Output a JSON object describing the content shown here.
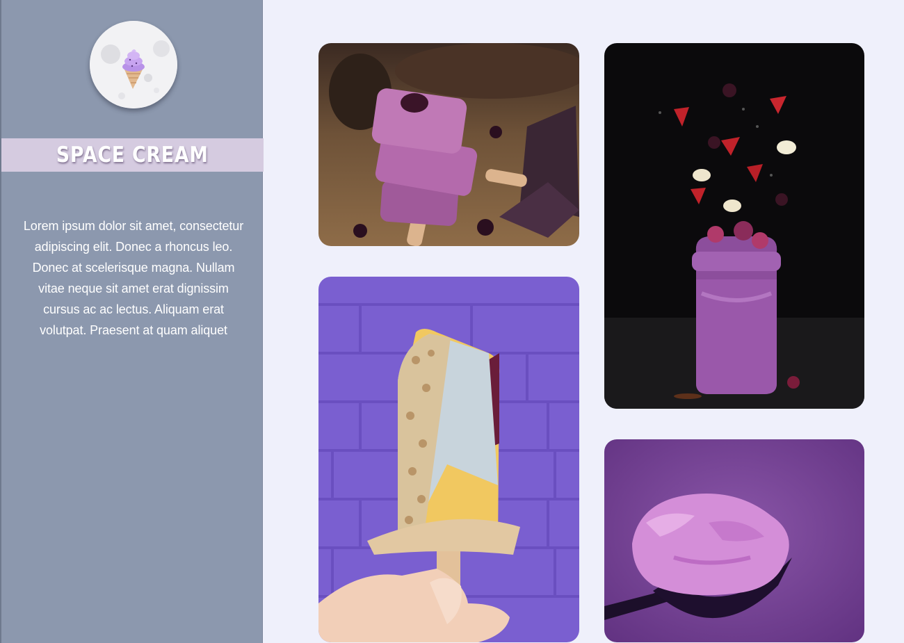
{
  "brand": {
    "name": "SPACE CREAM",
    "logo_icon": "ice-cream-cone-moon-icon"
  },
  "sidebar": {
    "description": "Lorem ipsum dolor sit amet, consectetur adipiscing elit. Donec a rhoncus leo. Donec at scelerisque magna. Nullam vitae neque sit amet erat dignissim cursus ac ac lectus. Aliquam erat volutpat. Praesent at quam aliquet"
  },
  "gallery": {
    "photos": [
      {
        "id": "popsicles",
        "subject": "stacked purple berry popsicles"
      },
      {
        "id": "held-popsicle",
        "subject": "hand holding nut-coated popsicle against purple brick wall"
      },
      {
        "id": "smoothie-jar",
        "subject": "purple berry smoothie jar with falling fruit"
      },
      {
        "id": "scoop",
        "subject": "scoop of purple ice cream"
      }
    ]
  },
  "colors": {
    "sidebar_bg": "#8c98ae",
    "title_band": "#d5cbe0",
    "page_bg": "#eff0fb",
    "accent_purple": "#7c5cd0"
  }
}
